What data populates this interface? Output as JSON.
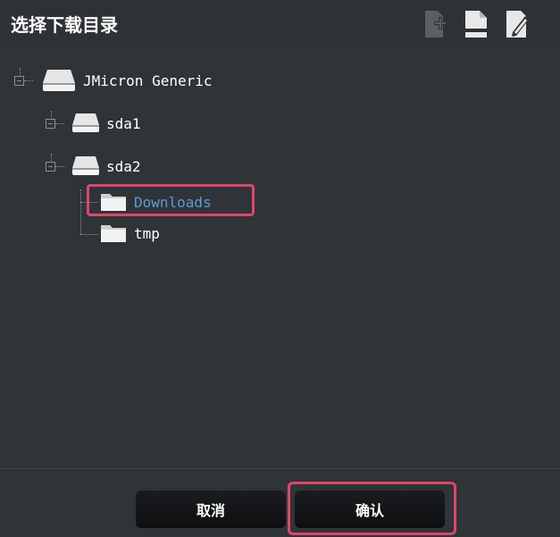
{
  "dialog": {
    "title": "选择下载目录"
  },
  "toolbar": {
    "icons": [
      "add-folder-icon",
      "drive-icon",
      "edit-icon"
    ]
  },
  "tree": {
    "root": {
      "label": "JMicron Generic",
      "icon": "drive-icon"
    },
    "children": [
      {
        "label": "sda1",
        "icon": "drive-icon"
      },
      {
        "label": "sda2",
        "icon": "drive-icon",
        "children": [
          {
            "label": "Downloads",
            "icon": "folder-icon",
            "selected": true
          },
          {
            "label": "tmp",
            "icon": "folder-icon"
          }
        ]
      }
    ]
  },
  "footer": {
    "cancel_label": "取消",
    "confirm_label": "确认"
  },
  "colors": {
    "accent": "#e0456a",
    "selected_text": "#5b9bd5"
  }
}
